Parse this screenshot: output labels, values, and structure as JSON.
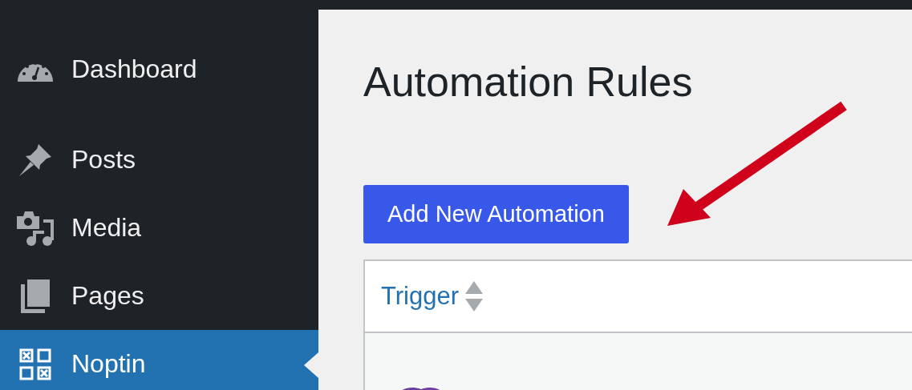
{
  "sidebar": {
    "items": [
      {
        "label": "Dashboard",
        "kind": "dashboard",
        "selected": false
      },
      {
        "label": "Posts",
        "kind": "posts",
        "selected": false
      },
      {
        "label": "Media",
        "kind": "media",
        "selected": false
      },
      {
        "label": "Pages",
        "kind": "pages",
        "selected": false
      },
      {
        "label": "Noptin",
        "kind": "noptin",
        "selected": true
      }
    ]
  },
  "page": {
    "title": "Automation Rules",
    "add_button": "Add New Automation"
  },
  "table": {
    "columns": [
      {
        "label": "Trigger",
        "sortable": true
      }
    ]
  }
}
